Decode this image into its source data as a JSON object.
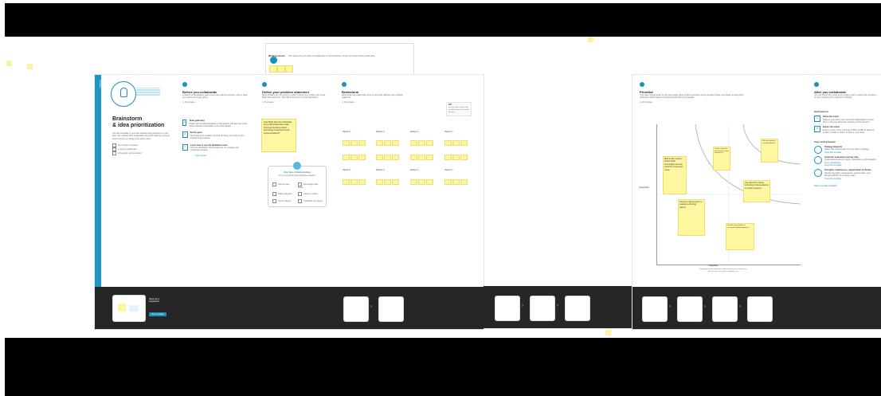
{
  "sidebar_tab": "Template",
  "intro": {
    "title_line1": "Brainstorm",
    "title_line2": "& idea prioritization",
    "description": "Use this template in your own brainstorming sessions so your team can unleash their imagination and start shaping concepts even if you're not sitting in the same room.",
    "checklist": [
      "10 minutes to prepare",
      "1 hour to collaborate",
      "2-8 people recommended"
    ],
    "footer_text": "Need some inspiration?",
    "footer_button": "Open example"
  },
  "tooltip": {
    "label": "Working session",
    "text": "This area is for your team to collaborate on the brainstorm. Drop your team's sticky notes here."
  },
  "step1": {
    "number": "1",
    "title": "Before you collaborate",
    "desc": "A little bit of preparation goes a long way with this session. Here's what you need to do to get going.",
    "time": "10 minutes",
    "items": [
      {
        "label": "A",
        "title": "Team gathering",
        "text": "Define who should participate in the session and send an invite. Share relevant information or pre-work ahead."
      },
      {
        "label": "B",
        "title": "Set the goal",
        "text": "Think about the problem you'll be focusing on solving in the brainstorming session."
      },
      {
        "label": "C",
        "title": "Learn how to use the facilitation tools",
        "text": "Use the Facilitation Superpowers to run a happy and productive session."
      }
    ],
    "link": "Open article"
  },
  "step2": {
    "number": "2",
    "title": "Define your problem statement",
    "desc": "What problem are you trying to solve? Frame your problem as a How Might We statement. This will be the focus of your brainstorm.",
    "time": "5 minutes",
    "sticky_text": "How Might We help individuals and small businesses make informed decisions about technology investments and implementations?",
    "key_rules": "Key rules of brainstorming",
    "key_sub": "To run a smooth and productive session",
    "rules": [
      "Stay in topic.",
      "Encourage wild ideas.",
      "Defer judgment.",
      "Listen to others.",
      "Go for volume.",
      "If possible, be visual."
    ]
  },
  "step3": {
    "number": "3",
    "title": "Brainstorm",
    "desc": "Write down any ideas that come to mind that address your problem statement.",
    "time": "10 minutes",
    "tip_label": "TIP",
    "tip_text": "You can select a sticky note and hit the pencil icon to start drawing!",
    "people": [
      "Person 1",
      "Person 2",
      "Person 3",
      "Person 4"
    ]
  },
  "step4": {
    "number": "4",
    "title": "Prioritize",
    "desc": "Your team should all be on the same page about what's important moving forward. Place your ideas on this grid to determine which ideas are important and which are feasible.",
    "time": "20 minutes",
    "y_label": "Importance",
    "x_label": "Feasibility",
    "x_note": "Regardless of their importance, which tasks are more feasible than others? (Cost, time, effort, complexity, etc.)",
    "notes": [
      "Build an ML model to predict which technologies are best suited for a business's needs.",
      "Create a forum for businesses to share experiences.",
      "Offer personalized recommendations.",
      "Use data from existing technology implementations to predict outcomes.",
      "Develop a rating system to evaluate technology options.",
      "Provide case studies of successful implementations."
    ]
  },
  "step5": {
    "title": "After you collaborate",
    "desc": "You can export the mural as an image or pdf to share with members of your company who might find it helpful.",
    "quick_add": "Quick add-ons",
    "addons": [
      {
        "label": "A",
        "title": "Share the mural",
        "text": "Share a view link to the mural with stakeholders to keep them in the loop about the outcomes of the session."
      },
      {
        "label": "B",
        "title": "Export the mural",
        "text": "Export a copy of the mural as a PNG or PDF to attach to emails, include in slides, or save in your drive."
      }
    ],
    "keep_moving": "Keep moving forward",
    "strategies": [
      {
        "title": "Strategy blueprint",
        "text": "Define the components of a new idea or strategy."
      },
      {
        "title": "Customer experience journey map",
        "text": "Understand customer needs, motivations, and obstacles for an experience."
      },
      {
        "title": "Strengths, weaknesses, opportunities & threats",
        "text": "Identify strengths, weaknesses, opportunities, and threats (SWOT) to develop a plan."
      }
    ],
    "open_template": "Open the template",
    "share_feedback": "Share template feedback"
  },
  "colors": {
    "accent": "#1c97c6",
    "sticky": "#fff6a0",
    "footer": "#262626"
  }
}
